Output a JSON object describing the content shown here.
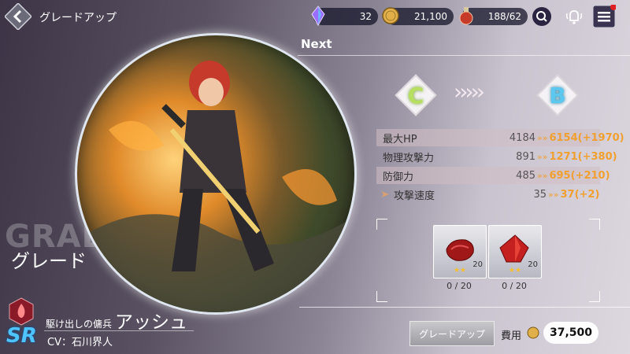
{
  "header": {
    "title": "グレードアップ",
    "resources": [
      {
        "name": "crystal",
        "icon": "crystal-icon",
        "value": "32"
      },
      {
        "name": "gold",
        "icon": "gold-coin-icon",
        "value": "21,100"
      },
      {
        "name": "stamina",
        "icon": "potion-icon",
        "value": "188/62"
      }
    ]
  },
  "grade": {
    "watermark": "GRADE",
    "label": "グレード",
    "next_label": "Next",
    "current": "C",
    "next": "B"
  },
  "stats": [
    {
      "name": "最大HP",
      "icon": "heart-icon",
      "current": "4184",
      "next": "6154",
      "delta": "(+1970)"
    },
    {
      "name": "物理攻撃力",
      "icon": "sword-icon",
      "current": "891",
      "next": "1271",
      "delta": "(+380)"
    },
    {
      "name": "防御力",
      "icon": "shield-icon",
      "current": "485",
      "next": "695",
      "delta": "(+210)"
    },
    {
      "name": "攻撃速度",
      "icon": "speed-icon",
      "current": "35",
      "next": "37",
      "delta": "(+2)"
    }
  ],
  "materials": [
    {
      "name": "red-cloth",
      "icon": "red-cloth-icon",
      "badge_count": "20",
      "stars": "★★",
      "owned_needed": "0 / 20"
    },
    {
      "name": "red-gem",
      "icon": "red-gem-icon",
      "badge_count": "20",
      "stars": "★★",
      "owned_needed": "0 / 20"
    }
  ],
  "character": {
    "rarity": "SR",
    "epithet": "駆け出しの傭兵",
    "name": "アッシュ",
    "cv": "CV：石川界人"
  },
  "footer": {
    "upgrade_button": "グレードアップ",
    "cost_label": "費用",
    "cost_value": "37,500"
  },
  "colors": {
    "accent_orange": "#f0a030",
    "grade_c": "#b8e060",
    "grade_b": "#5cc8f0",
    "sr_blue": "#4ec4ff"
  }
}
